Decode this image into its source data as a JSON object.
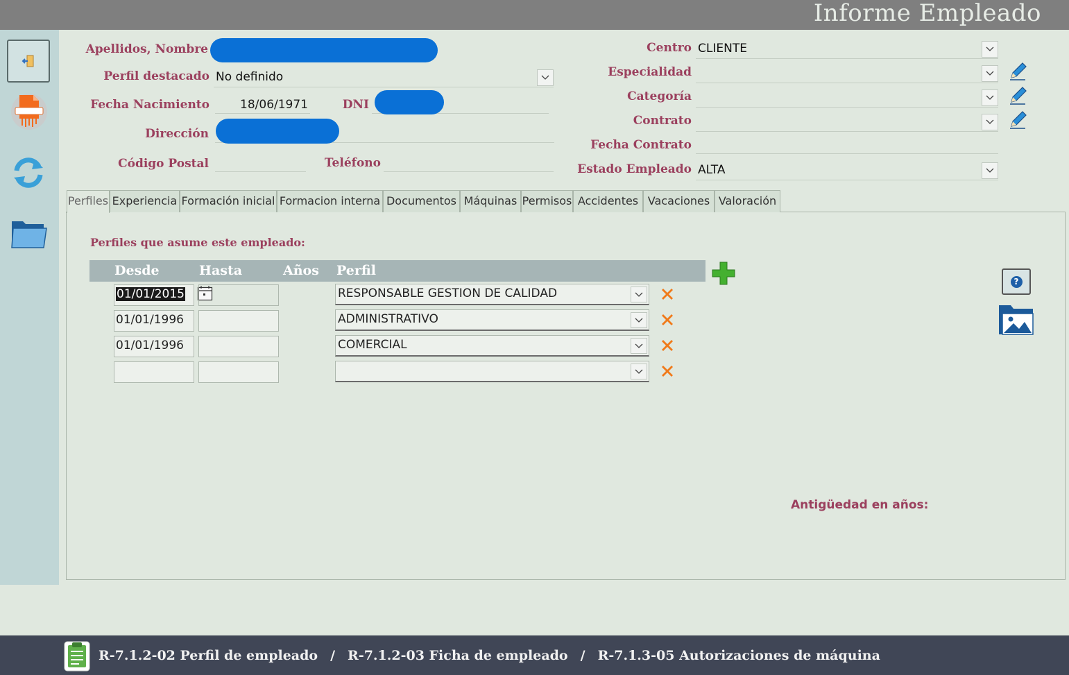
{
  "window": {
    "title": "Informe Empleado"
  },
  "form": {
    "apellidos_label": "Apellidos, Nombre",
    "perfil_destacado_label": "Perfil destacado",
    "perfil_destacado_value": "No definido",
    "fecha_nacimiento_label": "Fecha Nacimiento",
    "fecha_nacimiento_value": "18/06/1971",
    "dni_label": "DNI",
    "direccion_label": "Dirección",
    "codigo_postal_label": "Código Postal",
    "telefono_label": "Teléfono",
    "centro_label": "Centro",
    "centro_value": "CLIENTE",
    "especialidad_label": "Especialidad",
    "categoria_label": "Categoría",
    "contrato_label": "Contrato",
    "fecha_contrato_label": "Fecha Contrato",
    "estado_label": "Estado Empleado",
    "estado_value": "ALTA"
  },
  "tabs": [
    {
      "label": "Perfiles"
    },
    {
      "label": "Experiencia"
    },
    {
      "label": "Formación inicial"
    },
    {
      "label": "Formacion interna"
    },
    {
      "label": "Documentos"
    },
    {
      "label": "Máquinas"
    },
    {
      "label": "Permisos"
    },
    {
      "label": "Accidentes"
    },
    {
      "label": "Vacaciones"
    },
    {
      "label": "Valoración"
    }
  ],
  "perfiles": {
    "section_title": "Perfiles que asume este empleado:",
    "columns": [
      "Desde",
      "Hasta",
      "Años",
      "Perfil"
    ],
    "rows": [
      {
        "desde": "01/01/2015",
        "hasta": "",
        "perfil": "RESPONSABLE GESTION DE CALIDAD"
      },
      {
        "desde": "01/01/1996",
        "hasta": "",
        "perfil": "ADMINISTRATIVO"
      },
      {
        "desde": "01/01/1996",
        "hasta": "",
        "perfil": "COMERCIAL"
      },
      {
        "desde": "",
        "hasta": "",
        "perfil": ""
      }
    ],
    "antiguedad_label": "Antigüedad en años:",
    "help_label": "?"
  },
  "footer": {
    "links": [
      "R-7.1.2-02 Perfil de empleado",
      "R-7.1.2-03 Ficha de empleado",
      "R-7.1.3-05 Autorizaciones de máquina"
    ],
    "separator": "/"
  },
  "icons": {
    "exit": "exit-door-icon",
    "pdf": "pdf-report-icon",
    "refresh": "refresh-icon",
    "folder": "folder-icon",
    "edit": "pencil-icon",
    "add": "plus-icon",
    "delete": "delete-x-icon",
    "help": "help-icon",
    "photo": "photo-folder-icon",
    "clipboard": "clipboard-icon"
  },
  "colors": {
    "label": "#9b405e",
    "footer": "#404656",
    "titlebar": "#7f7f7f",
    "redaction": "#0a70d6"
  }
}
